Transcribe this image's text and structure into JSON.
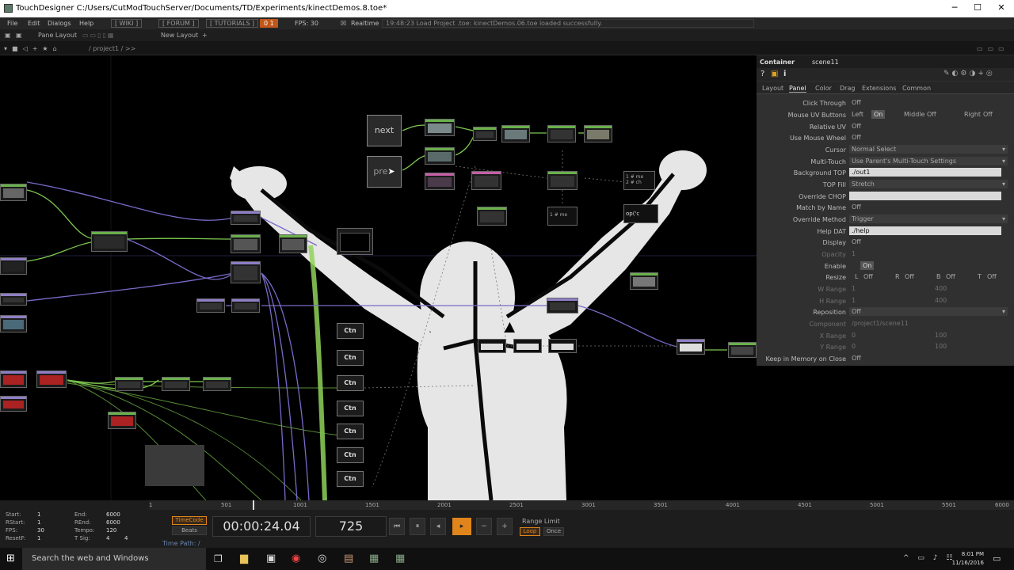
{
  "window": {
    "title": "TouchDesigner C:/Users/CutModTouchServer/Documents/TD/Experiments/kinectDemos.8.toe*",
    "minimize_icon": "─",
    "maximize_icon": "☐",
    "close_icon": "✕"
  },
  "menu": {
    "items": [
      "File",
      "Edit",
      "Dialogs",
      "Help"
    ],
    "wiki": "[ WIKI ]",
    "forum": "[ FORUM ]",
    "tutorials": "[ TUTORIALS ]",
    "perf_badge": "0 1",
    "fps_label": "FPS: 30",
    "realtime": "Realtime",
    "status_message": "19:48:23 Load Project .toe: kinectDemos.06.toe loaded successfully."
  },
  "toolbar": {
    "pane_layout": "Pane Layout",
    "new_layout": "New Layout",
    "add": "+"
  },
  "pathbar": {
    "path": "/ project1 / >>"
  },
  "network": {
    "next_label": "next",
    "prev_label": "pre",
    "ctn_label": "Ctn",
    "op_text": "op('c",
    "dat_line1": "1 # me",
    "dat_line2": "2 # ch"
  },
  "params": {
    "op_type": "Container",
    "op_name": "scene11",
    "tabs": [
      "Layout",
      "Panel",
      "Color",
      "Drag",
      "Extensions",
      "Common"
    ],
    "active_tab": "Panel",
    "rows": [
      {
        "label": "Click Through",
        "value": "Off"
      },
      {
        "label": "Mouse UV Buttons",
        "value": "Left",
        "extra": [
          "On",
          "Middle",
          "Off",
          "Right",
          "Off"
        ]
      },
      {
        "label": "Relative UV",
        "value": "Off"
      },
      {
        "label": "Use Mouse Wheel",
        "value": "Off"
      },
      {
        "label": "Cursor",
        "value": "Normal Select"
      },
      {
        "label": "Multi-Touch",
        "value": "Use Parent's Multi-Touch Settings"
      },
      {
        "label": "Background TOP",
        "value": "./out1"
      },
      {
        "label": "TOP Fill",
        "value": "Stretch"
      },
      {
        "label": "Override CHOP",
        "value": ""
      },
      {
        "label": "Match by Name",
        "value": "Off"
      },
      {
        "label": "Override Method",
        "value": "Trigger"
      },
      {
        "label": "Help DAT",
        "value": "./help"
      },
      {
        "label": "Display",
        "value": "Off"
      },
      {
        "label": "Opacity",
        "value": "1"
      },
      {
        "label": "Enable",
        "value": "On"
      },
      {
        "label": "Resize",
        "value": "L",
        "extra": [
          "Off",
          "R",
          "Off",
          "B",
          "Off",
          "T",
          "Off"
        ]
      },
      {
        "label": "W Range",
        "value": "1",
        "extra": [
          "400"
        ]
      },
      {
        "label": "H Range",
        "value": "1",
        "extra": [
          "400"
        ]
      },
      {
        "label": "Reposition",
        "value": "Off"
      },
      {
        "label": "Component",
        "value": "/project1/scene11"
      },
      {
        "label": "X Range",
        "value": "0",
        "extra": [
          "100"
        ]
      },
      {
        "label": "Y Range",
        "value": "0",
        "extra": [
          "100"
        ]
      },
      {
        "label": "Keep in Memory on Close",
        "value": "Off"
      }
    ]
  },
  "timeline": {
    "ticks": [
      "1",
      "501",
      "1001",
      "1501",
      "2001",
      "2501",
      "3001",
      "3501",
      "4001",
      "4501",
      "5001",
      "5501",
      "6000"
    ],
    "start_label": "Start:",
    "start": "1",
    "end_label": "End:",
    "end": "6000",
    "rstart_label": "RStart:",
    "rstart": "1",
    "rend_label": "REnd:",
    "rend": "6000",
    "fps_label": "FPS:",
    "fps": "30",
    "tempo_label": "Tempo:",
    "tempo": "120",
    "resetf_label": "ResetF:",
    "resetf": "1",
    "tsig_label": "T Sig:",
    "tsig_a": "4",
    "tsig_b": "4",
    "timecode_label": "TimeCode",
    "beats_label": "Beats",
    "timecode": "00:00:24.04",
    "frame": "725",
    "range_limit": "Range Limit",
    "loop": "Loop",
    "once": "Once",
    "time_path": "Time Path: /"
  },
  "taskbar": {
    "search_placeholder": "Search the web and Windows",
    "time": "8:01 PM",
    "date": "11/16/2016"
  },
  "colors": {
    "green_wire": "#7ec850",
    "purple_wire": "#7a6ac9",
    "accent_orange": "#e0841c",
    "panel_bg": "#303030"
  }
}
